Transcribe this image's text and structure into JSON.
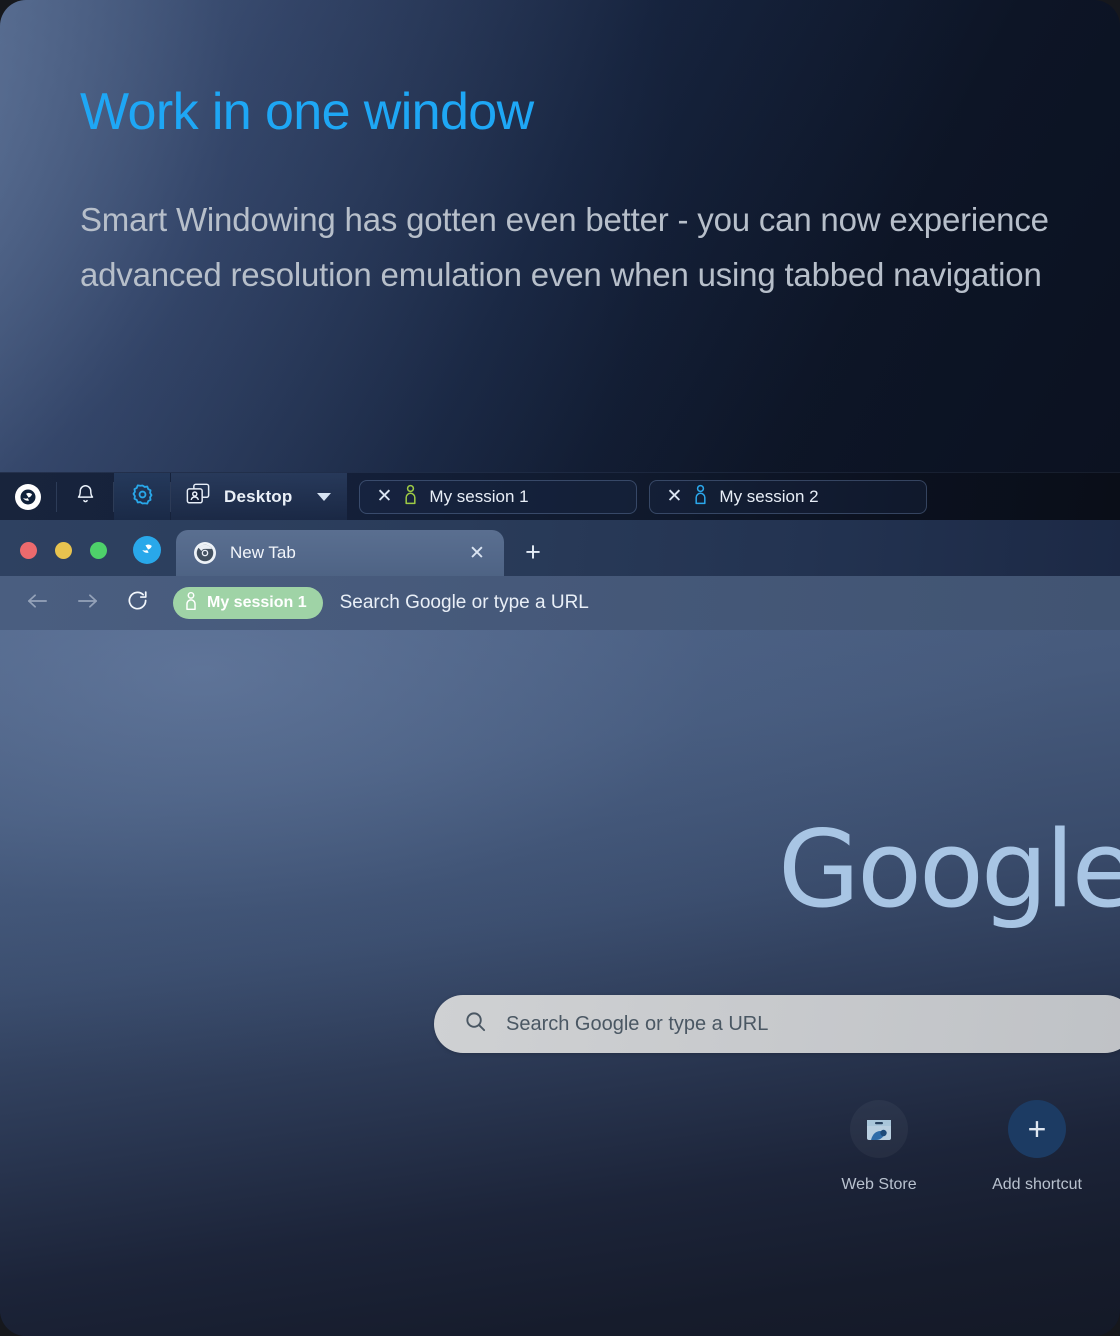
{
  "hero": {
    "title": "Work in one window",
    "subtitle": "Smart Windowing has gotten even better - you can now experience advanced resolution emulation even when using tabbed navigation",
    "title_color": "#1ea7f5",
    "subtitle_color": "#b7bfca"
  },
  "app_toolbar": {
    "logo_icon": "app-swirl-logo-icon",
    "notifications_icon": "bell-icon",
    "settings_icon": "gear-icon",
    "settings_active": true,
    "workspace": {
      "icon": "windows-person-stack-icon",
      "label": "Desktop",
      "caret_icon": "chevron-down-icon"
    },
    "sessions": [
      {
        "label": "My session 1",
        "close_icon": "close-icon",
        "person_icon": "person-icon",
        "person_color": "#9ecb45"
      },
      {
        "label": "My session 2",
        "close_icon": "close-icon",
        "person_icon": "person-icon",
        "person_color": "#2ba8ec"
      }
    ]
  },
  "browser": {
    "traffic_lights": [
      {
        "name": "close",
        "color": "#ec6a6d"
      },
      {
        "name": "minimize",
        "color": "#e8c34f"
      },
      {
        "name": "zoom",
        "color": "#4ed16a"
      }
    ],
    "brand_icon": "app-swirl-logo-icon",
    "tab": {
      "favicon": "chrome-icon",
      "title": "New Tab",
      "close_icon": "close-icon"
    },
    "new_tab_button": "+",
    "toolbar": {
      "back_icon": "arrow-left-icon",
      "forward_icon": "arrow-right-icon",
      "reload_icon": "reload-icon",
      "session_chip": {
        "icon": "person-icon",
        "label": "My session 1",
        "color": "#9fd3a6"
      },
      "omnibox_placeholder": "Search Google or type a URL"
    }
  },
  "ntp": {
    "logo_text": "Google",
    "logo_color": "#a8c5e4",
    "search": {
      "icon": "search-icon",
      "placeholder": "Search Google or type a URL"
    },
    "shortcuts": [
      {
        "label": "Web Store",
        "icon": "web-store-icon"
      },
      {
        "label": "Add shortcut",
        "icon": "plus-icon"
      }
    ]
  }
}
